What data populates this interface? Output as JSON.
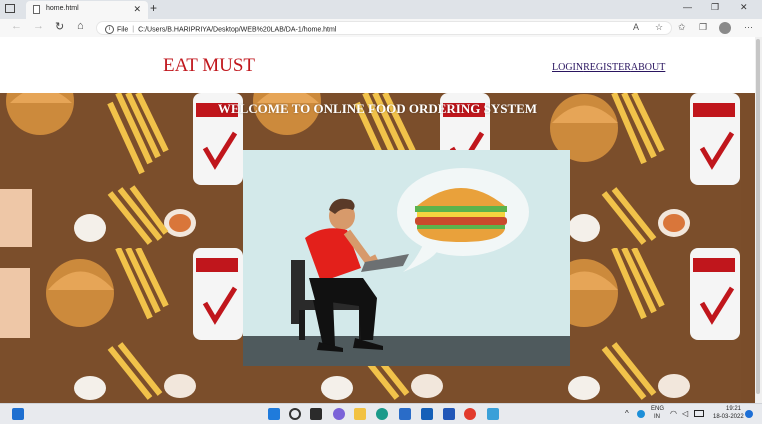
{
  "browser": {
    "tab_title": "home.html",
    "new_tab": "+",
    "url_scheme": "File",
    "url": "C:/Users/B.HARIPRIYA/Desktop/WEB%20LAB/DA-1/home.html",
    "window_controls": [
      "—",
      "❐",
      "✕"
    ]
  },
  "page": {
    "logo": "EAT MUST",
    "nav": {
      "login": "LOGIN",
      "register": "REGISTER",
      "about": "ABOUT"
    },
    "banner_title": "WELCOME TO ONLINE FOOD ORDERING SYSTEM"
  },
  "taskbar": {
    "language_top": "ENG",
    "language_bottom": "IN",
    "time": "19:21",
    "date": "18-03-2022"
  },
  "colors": {
    "logo": "#c0161c",
    "nav_link": "#2a1560",
    "banner_bg": "#7a4d2a",
    "illustration_bg": "#d3e9ea",
    "shirt": "#e3201b"
  }
}
